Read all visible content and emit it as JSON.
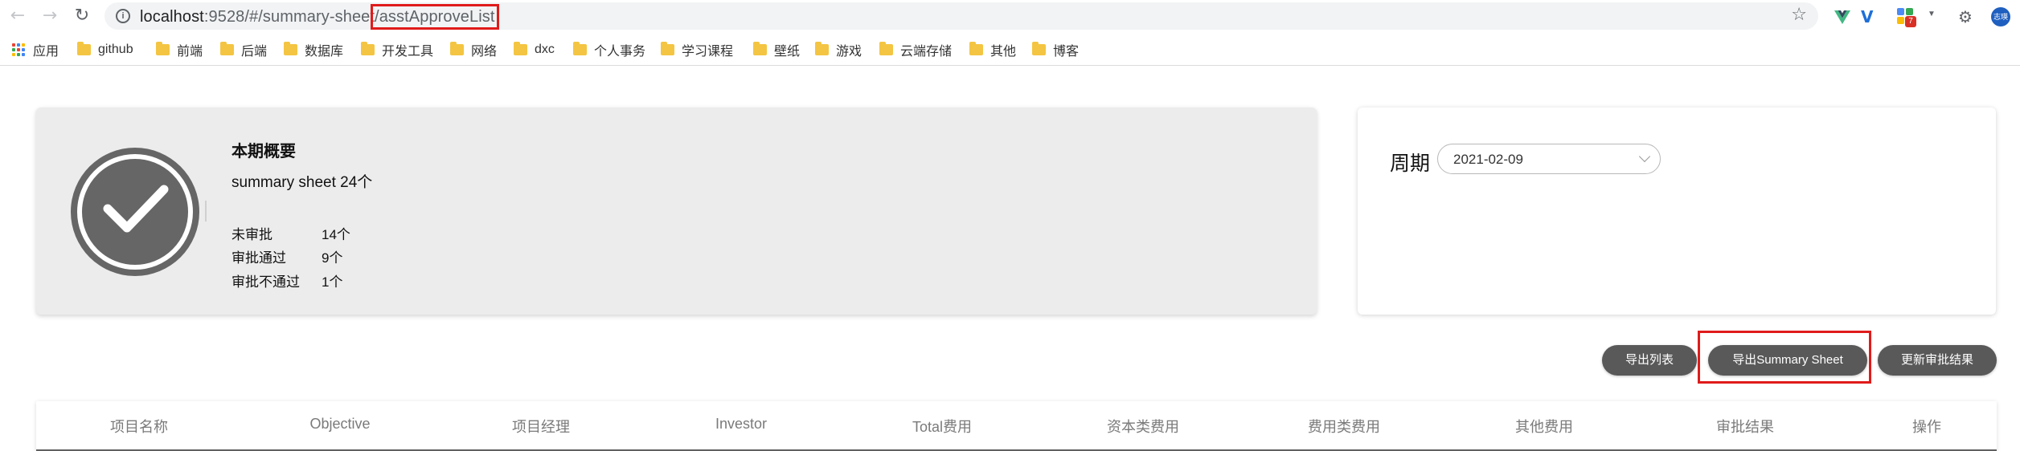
{
  "browser": {
    "url_host": "localhost",
    "url_path": ":9528/#/summary-sheet",
    "url_highlight": "/asstApproveList",
    "profile_initials": "志瑛",
    "extension_badge": "7"
  },
  "bookmarks": [
    {
      "label": "应用",
      "icon": "apps-icon"
    },
    {
      "label": "github",
      "icon": "folder-icon"
    },
    {
      "label": "前端",
      "icon": "folder-icon"
    },
    {
      "label": "后端",
      "icon": "folder-icon"
    },
    {
      "label": "数据库",
      "icon": "folder-icon"
    },
    {
      "label": "开发工具",
      "icon": "folder-icon"
    },
    {
      "label": "网络",
      "icon": "folder-icon"
    },
    {
      "label": "dxc",
      "icon": "folder-icon"
    },
    {
      "label": "个人事务",
      "icon": "folder-icon"
    },
    {
      "label": "学习课程",
      "icon": "folder-icon"
    },
    {
      "label": "壁纸",
      "icon": "folder-icon"
    },
    {
      "label": "游戏",
      "icon": "folder-icon"
    },
    {
      "label": "云端存储",
      "icon": "folder-icon"
    },
    {
      "label": "其他",
      "icon": "folder-icon"
    },
    {
      "label": "博客",
      "icon": "folder-icon"
    }
  ],
  "summary": {
    "title": "本期概要",
    "count_text": "summary sheet 24个",
    "stats": [
      {
        "label": "未审批",
        "value": "14个"
      },
      {
        "label": "审批通过",
        "value": "9个"
      },
      {
        "label": "审批不通过",
        "value": "1个"
      }
    ]
  },
  "period": {
    "label": "周期",
    "value": "2021-02-09"
  },
  "actions": {
    "export_list": "导出列表",
    "export_summary": "导出Summary Sheet",
    "update_results": "更新审批结果"
  },
  "table": {
    "columns": [
      "项目名称",
      "Objective",
      "项目经理",
      "Investor",
      "Total费用",
      "资本类费用",
      "费用类费用",
      "其他费用",
      "审批结果",
      "操作"
    ]
  },
  "colors": {
    "highlight": "#e01b1b",
    "button": "#595959",
    "badge": "#666666"
  }
}
